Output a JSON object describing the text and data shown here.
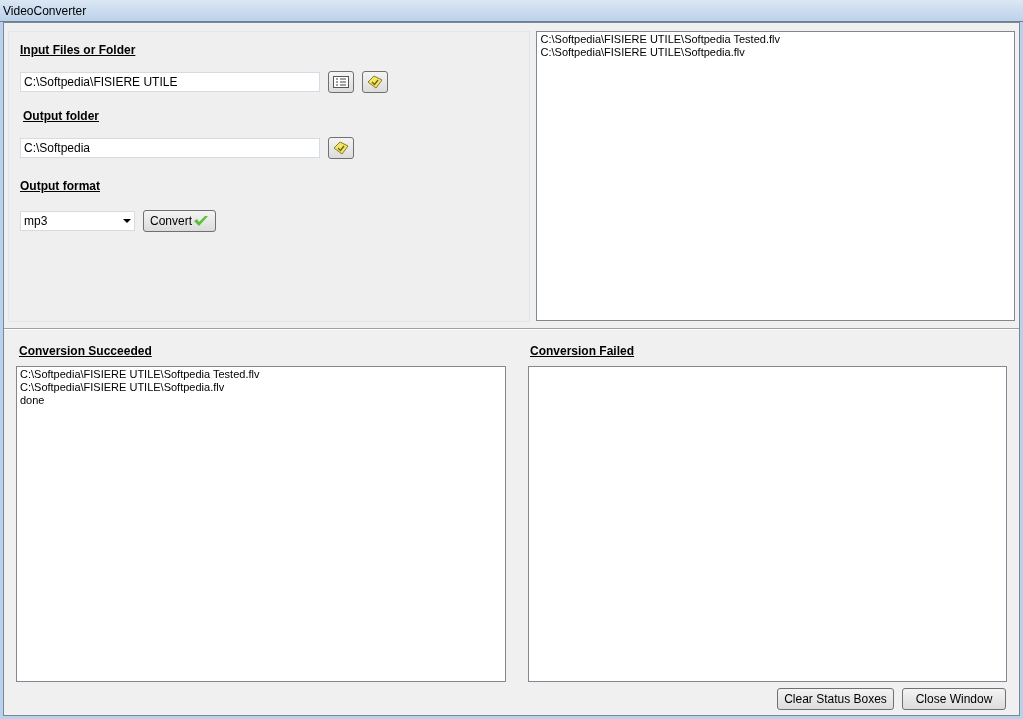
{
  "window": {
    "title": "VideoConverter"
  },
  "input": {
    "label": "Input Files or Folder",
    "value": "C:\\Softpedia\\FISIERE UTILE"
  },
  "output_folder": {
    "label": "Output folder",
    "value": "C:\\Softpedia"
  },
  "output_format": {
    "label": "Output format",
    "value": "mp3"
  },
  "convert_button": {
    "label": "Convert"
  },
  "file_list": [
    "C:\\Softpedia\\FISIERE UTILE\\Softpedia Tested.flv",
    "C:\\Softpedia\\FISIERE UTILE\\Softpedia.flv"
  ],
  "succeeded": {
    "heading": "Conversion Succeeded",
    "lines": [
      "C:\\Softpedia\\FISIERE UTILE\\Softpedia Tested.flv",
      "C:\\Softpedia\\FISIERE UTILE\\Softpedia.flv",
      "done"
    ]
  },
  "failed": {
    "heading": "Conversion Failed"
  },
  "buttons": [
    "Clear Status Boxes",
    "Close Window"
  ]
}
